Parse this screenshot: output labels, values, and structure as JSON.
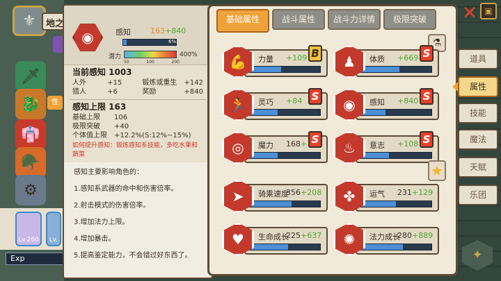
{
  "left": {
    "name": "地之",
    "avatar_level": "Lv.260",
    "avatar2_level": "Lv.",
    "exp_label": "Exp",
    "tag": "性"
  },
  "detail": {
    "title": "感知",
    "value": "163",
    "bonus": "+840",
    "bar_pct_label": "6%",
    "bar_fill": 0.06,
    "potential_label": "潜力",
    "potential_ticks": [
      "50",
      "100",
      "200"
    ],
    "potential_max": "400%",
    "current_title": "当前感知 1003",
    "current_rows": [
      {
        "a": "人外",
        "b": "+15",
        "c": "锻炼或重生",
        "d": "+142"
      },
      {
        "a": "猎人",
        "b": "+6",
        "c": "奖励",
        "d": "+840"
      }
    ],
    "limit_title": "感知上限 163",
    "limit_rows": [
      {
        "a": "基础上限",
        "b": "106"
      },
      {
        "a": "极限突破",
        "b": "+40"
      },
      {
        "a": "个体值上限",
        "b": "+12.2%(S:12%~15%)"
      }
    ],
    "tip": "如何提升感知：锻炼感知系技能，多吃水果和蔬菜",
    "desc": [
      "感知主要影响角色的：",
      "1.感知系武器的命中和伤害倍率。",
      "2.射击模式的伤害倍率。",
      "3.增加法力上限。",
      "4.增加暴击。",
      "5.提高鉴定能力，不会错过好东西了。"
    ]
  },
  "tabs": [
    "基础属性",
    "战斗属性",
    "战斗力详情",
    "极限突破"
  ],
  "attributes": [
    {
      "name": "力量",
      "base": "",
      "bonus": "+109",
      "grade": "B",
      "icon": "arm-icon",
      "fill": 0.45
    },
    {
      "name": "体质",
      "base": "",
      "bonus": "+669",
      "grade": "S",
      "icon": "body-icon",
      "fill": 0.55
    },
    {
      "name": "灵巧",
      "base": "",
      "bonus": "+84",
      "grade": "S",
      "icon": "runner-icon",
      "fill": 0.4
    },
    {
      "name": "感知",
      "base": "",
      "bonus": "+840",
      "grade": "S",
      "icon": "eye-icon",
      "fill": 0.35
    },
    {
      "name": "魔力",
      "base": "168",
      "bonus": "+178",
      "grade": "S",
      "icon": "swirl-icon",
      "fill": 0.4
    },
    {
      "name": "意志",
      "base": "",
      "bonus": "+108",
      "grade": "S",
      "icon": "flame-icon",
      "fill": 0.4
    },
    {
      "name": "骑乘速度",
      "base": "356",
      "bonus": "+208",
      "grade": "",
      "icon": "speed-icon",
      "fill": 0.6
    },
    {
      "name": "运气",
      "base": "231",
      "bonus": "+129",
      "grade": "",
      "icon": "clover-icon",
      "fill": 0.5
    },
    {
      "name": "生命成长",
      "base": "225",
      "bonus": "+637",
      "grade": "",
      "icon": "heart-icon",
      "fill": 0.55
    },
    {
      "name": "法力成长",
      "base": "280",
      "bonus": "+889",
      "grade": "",
      "icon": "mana-icon",
      "fill": 0.6
    }
  ],
  "sidebar": [
    "道具",
    "属性",
    "技能",
    "魔法",
    "天赋",
    "乐团"
  ]
}
